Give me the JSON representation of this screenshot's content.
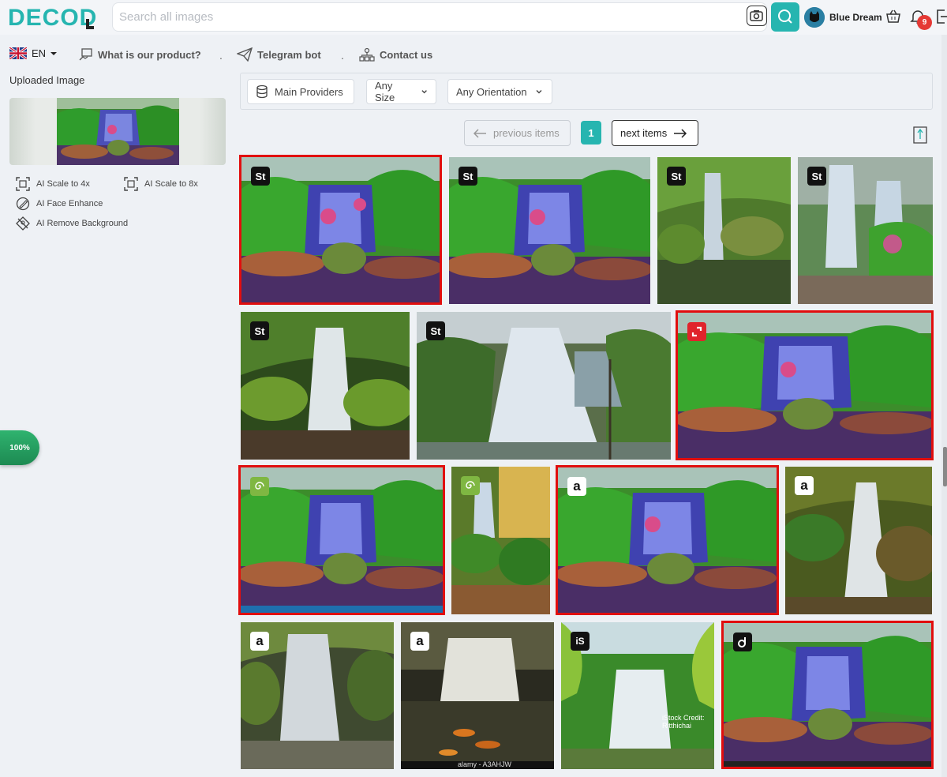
{
  "header": {
    "search_placeholder": "Search all images",
    "user_name": "Blue Dream",
    "notification_count": "9",
    "accent_color": "#26b5b0"
  },
  "nav": {
    "language": "EN",
    "items": [
      {
        "label": "What is our product?",
        "icon": "monitor-hand-icon"
      },
      {
        "label": "Telegram bot",
        "icon": "paper-plane-icon"
      },
      {
        "label": "Contact us",
        "icon": "people-network-icon"
      }
    ]
  },
  "left_panel": {
    "uploaded_label": "Uploaded Image",
    "tools": [
      {
        "label": "AI Scale to 4x",
        "icon": "scale-icon"
      },
      {
        "label": "AI Scale to 8x",
        "icon": "scale-icon"
      },
      {
        "label": "AI Face Enhance",
        "icon": "face-edit-icon"
      },
      {
        "label": "AI Remove Background",
        "icon": "remove-bg-icon"
      }
    ],
    "progress": "100%"
  },
  "filters": {
    "provider": "Main Providers",
    "size": "Any Size",
    "orientation": "Any Orientation"
  },
  "pagination": {
    "prev_label": "previous items",
    "current_page": "1",
    "next_label": "next items"
  },
  "results": [
    {
      "provider": "St",
      "provider_name": "Adobe Stock",
      "selected": true
    },
    {
      "provider": "St",
      "provider_name": "Adobe Stock",
      "selected": false
    },
    {
      "provider": "St",
      "provider_name": "Adobe Stock",
      "selected": false
    },
    {
      "provider": "St",
      "provider_name": "Adobe Stock",
      "selected": false
    },
    {
      "provider": "St",
      "provider_name": "Adobe Stock",
      "selected": false
    },
    {
      "provider": "St",
      "provider_name": "Adobe Stock",
      "selected": false
    },
    {
      "provider": "shutterstock",
      "provider_name": "Shutterstock",
      "selected": true
    },
    {
      "provider": "dreamstime",
      "provider_name": "Dreamstime",
      "selected": true
    },
    {
      "provider": "dreamstime",
      "provider_name": "Dreamstime",
      "selected": false
    },
    {
      "provider": "a",
      "provider_name": "Alamy",
      "selected": true
    },
    {
      "provider": "a",
      "provider_name": "Alamy",
      "selected": false
    },
    {
      "provider": "a",
      "provider_name": "Alamy",
      "selected": false
    },
    {
      "provider": "a",
      "provider_name": "Alamy",
      "selected": false,
      "watermark": "alamy - A3AHJW"
    },
    {
      "provider": "iS",
      "provider_name": "iStock",
      "selected": false,
      "watermark": "iStock Credit: Ritthichai"
    },
    {
      "provider": "d",
      "provider_name": "Depositphotos",
      "selected": true
    }
  ]
}
